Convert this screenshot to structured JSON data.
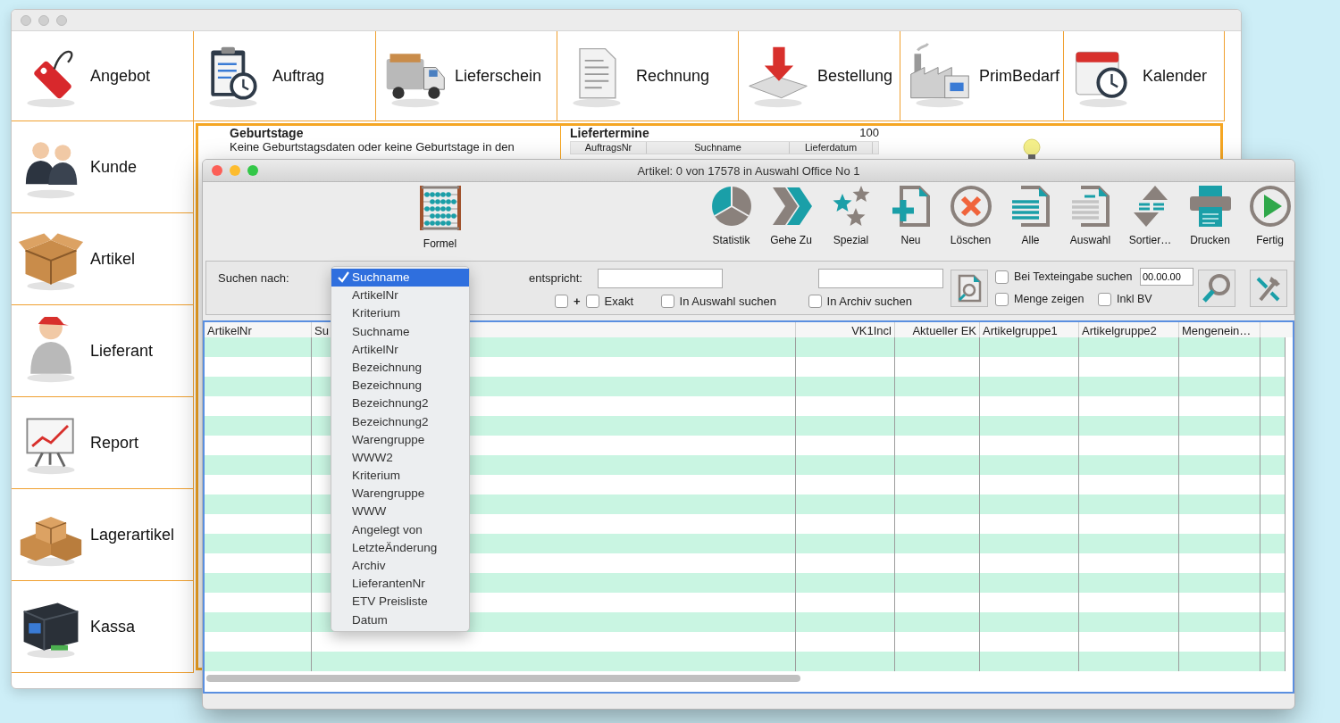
{
  "main_window": {
    "top_tiles": [
      {
        "label": "Angebot"
      },
      {
        "label": "Auftrag"
      },
      {
        "label": "Lieferschein"
      },
      {
        "label": "Rechnung"
      },
      {
        "label": "Bestellung"
      },
      {
        "label": "PrimBedarf"
      },
      {
        "label": "Kalender"
      }
    ],
    "side_tiles": [
      {
        "label": "Kunde"
      },
      {
        "label": "Artikel"
      },
      {
        "label": "Lieferant"
      },
      {
        "label": "Report"
      },
      {
        "label": "Lagerartikel"
      },
      {
        "label": "Kassa"
      }
    ],
    "dashboard": {
      "birthdays": {
        "title": "Geburtstage",
        "text": "Keine Geburtstagsdaten oder keine Geburtstage in den"
      },
      "deliveries": {
        "title": "Liefertermine",
        "count": "100",
        "columns": [
          "AuftragsNr",
          "Suchname",
          "Lieferdatum"
        ]
      }
    }
  },
  "article_window": {
    "title": "Artikel: 0 von 17578 in Auswahl Office No 1",
    "toolbar_left": [
      {
        "label": "Formel"
      }
    ],
    "toolbar": [
      {
        "label": "Statistik"
      },
      {
        "label": "Gehe Zu"
      },
      {
        "label": "Spezial"
      },
      {
        "label": "Neu"
      },
      {
        "label": "Löschen"
      },
      {
        "label": "Alle"
      },
      {
        "label": "Auswahl"
      },
      {
        "label": "Sortier…"
      },
      {
        "label": "Drucken"
      },
      {
        "label": "Fertig"
      }
    ],
    "search": {
      "label": "Suchen nach:",
      "match_label": "entspricht:",
      "date_value": "00.00.00",
      "checkboxes": [
        {
          "label": "+",
          "checked": false
        },
        {
          "label": "Exakt",
          "checked": false
        },
        {
          "label": "In Auswahl suchen",
          "checked": false
        },
        {
          "label": "In Archiv suchen",
          "checked": false
        },
        {
          "label": "Bei Texteingabe suchen",
          "checked": false
        },
        {
          "label": "Menge zeigen",
          "checked": false
        },
        {
          "label": "Inkl BV",
          "checked": false
        }
      ]
    },
    "dropdown": {
      "items": [
        {
          "label": "Suchname",
          "selected": true
        },
        {
          "label": "ArtikelNr",
          "selected": false
        },
        {
          "label": "Kriterium",
          "selected": false
        },
        {
          "label": "Suchname",
          "selected": false
        },
        {
          "label": "ArtikelNr",
          "selected": false
        },
        {
          "label": "Bezeichnung",
          "selected": false
        },
        {
          "label": "Bezeichnung",
          "selected": false
        },
        {
          "label": "Bezeichnung2",
          "selected": false
        },
        {
          "label": "Bezeichnung2",
          "selected": false
        },
        {
          "label": "Warengruppe",
          "selected": false
        },
        {
          "label": "WWW2",
          "selected": false
        },
        {
          "label": "Kriterium",
          "selected": false
        },
        {
          "label": "Warengruppe",
          "selected": false
        },
        {
          "label": "WWW",
          "selected": false
        },
        {
          "label": "Angelegt von",
          "selected": false
        },
        {
          "label": "LetzteÄnderung",
          "selected": false
        },
        {
          "label": "Archiv",
          "selected": false
        },
        {
          "label": "LieferantenNr",
          "selected": false
        },
        {
          "label": "ETV Preisliste",
          "selected": false
        },
        {
          "label": "Datum",
          "selected": false
        }
      ]
    },
    "table": {
      "columns": [
        "ArtikelNr",
        "Su",
        "VK1Incl",
        "Aktueller EK",
        "Artikelgruppe1",
        "Artikelgruppe2",
        "Mengenein…"
      ]
    }
  }
}
